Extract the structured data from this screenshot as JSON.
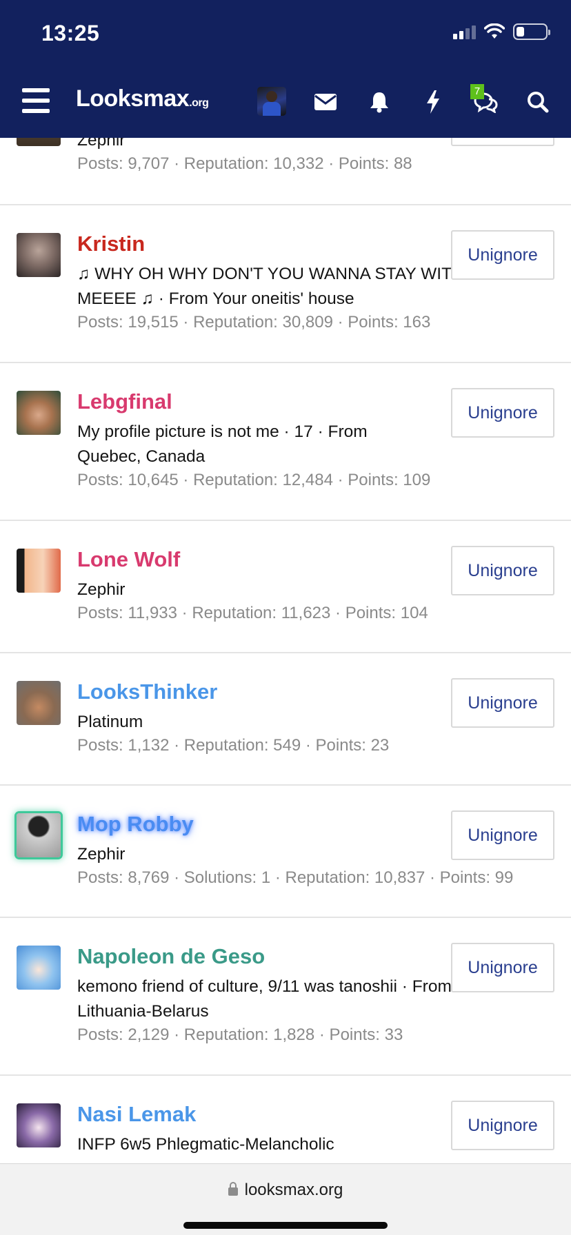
{
  "status_bar": {
    "time": "13:25"
  },
  "navbar": {
    "logo": "Looksmax",
    "logo_suffix": ".org",
    "conversations_badge": "7",
    "icons": [
      "menu-icon",
      "envelope-icon",
      "bell-icon",
      "lightning-icon",
      "chat-bubbles-icon",
      "search-icon"
    ]
  },
  "colors": {
    "header_bg": "#12215e",
    "button_text": "#2a3f8f",
    "badge_bg": "#5ec01b"
  },
  "members": [
    {
      "name": "",
      "info": "Zephir",
      "stats": "Posts: 9,707 · Reputation: 10,332 · Points: 88",
      "button": "Unignore"
    },
    {
      "name": "Kristin",
      "info": "♫ WHY OH WHY DON'T YOU WANNA STAY WITH MEEEE ♫ · From Your oneitis' house",
      "stats": "Posts: 19,515 · Reputation: 30,809 · Points: 163",
      "button": "Unignore"
    },
    {
      "name": "Lebgfinal",
      "info": "My profile picture is not me · 17 · From Quebec, Canada",
      "stats": "Posts: 10,645 · Reputation: 12,484 · Points: 109",
      "button": "Unignore"
    },
    {
      "name": "Lone Wolf",
      "info": "Zephir",
      "stats": "Posts: 11,933 · Reputation: 11,623 · Points: 104",
      "button": "Unignore"
    },
    {
      "name": "LooksThinker",
      "info": "Platinum",
      "stats": "Posts: 1,132 · Reputation: 549 · Points: 23",
      "button": "Unignore"
    },
    {
      "name": "Mop Robby",
      "info": "Zephir",
      "stats": "Posts: 8,769 · Solutions: 1 · Reputation: 10,837 · Points: 99",
      "button": "Unignore"
    },
    {
      "name": "Napoleon de Geso",
      "info": "kemono friend of culture, 9/11 was tanoshii · From Lithuania-Belarus",
      "stats": "Posts: 2,129 · Reputation: 1,828 · Points: 33",
      "button": "Unignore"
    },
    {
      "name": "Nasi Lemak",
      "info": "INFP 6w5 Phlegmatic-Melancholic",
      "stats": "",
      "button": "Unignore"
    }
  ],
  "browser": {
    "url": "looksmax.org"
  }
}
